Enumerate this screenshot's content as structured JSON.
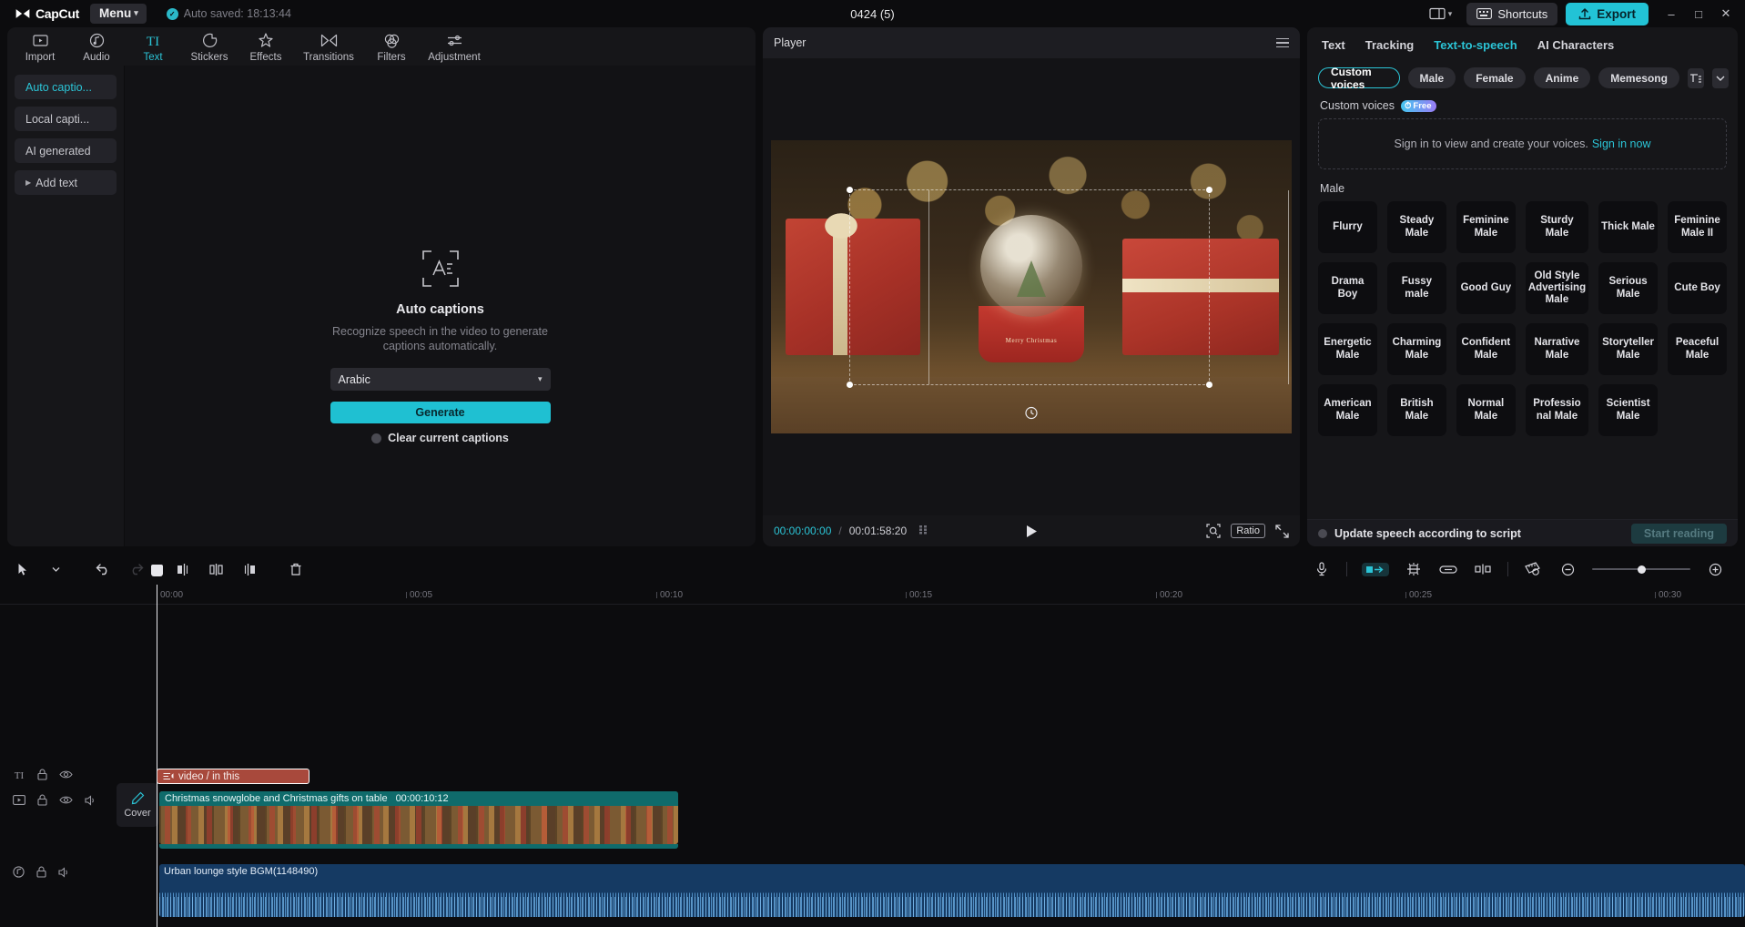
{
  "titlebar": {
    "brand": "CapCut",
    "menu_label": "Menu",
    "autosave_text": "Auto saved: 18:13:44",
    "project_title": "0424 (5)",
    "shortcuts_label": "Shortcuts",
    "export_label": "Export",
    "minimize": "–",
    "maximize": "□",
    "close": "✕"
  },
  "nav_tabs": [
    {
      "label": "Import",
      "icon": "import-icon",
      "active": false
    },
    {
      "label": "Audio",
      "icon": "audio-icon",
      "active": false
    },
    {
      "label": "Text",
      "icon": "text-icon",
      "active": true
    },
    {
      "label": "Stickers",
      "icon": "stickers-icon",
      "active": false
    },
    {
      "label": "Effects",
      "icon": "effects-icon",
      "active": false
    },
    {
      "label": "Transitions",
      "icon": "transitions-icon",
      "active": false
    },
    {
      "label": "Filters",
      "icon": "filters-icon",
      "active": false
    },
    {
      "label": "Adjustment",
      "icon": "adjustment-icon",
      "active": false
    }
  ],
  "subnav": [
    {
      "label": "Auto captio...",
      "active": true
    },
    {
      "label": "Local capti...",
      "active": false
    },
    {
      "label": "AI generated",
      "active": false
    },
    {
      "label": "Add text",
      "active": false,
      "expandable": true
    }
  ],
  "auto_captions": {
    "title": "Auto captions",
    "description": "Recognize speech in the video to generate captions automatically.",
    "language_value": "Arabic",
    "generate_label": "Generate",
    "clear_label": "Clear current captions",
    "clear_checked": false
  },
  "player": {
    "header_title": "Player",
    "current_time": "00:00:00:00",
    "separator": "/",
    "total_time": "00:01:58:20",
    "ratio_label": "Ratio",
    "play_icon": "play-icon",
    "zoom_icon": "magnifier-icon",
    "fullscreen_icon": "fullscreen-icon",
    "menu_icon": "hamburger-icon"
  },
  "right_panel": {
    "tabs": [
      {
        "label": "Text",
        "active": false
      },
      {
        "label": "Tracking",
        "active": false
      },
      {
        "label": "Text-to-speech",
        "active": true
      },
      {
        "label": "AI Characters",
        "active": false
      }
    ],
    "filter_chips": [
      {
        "label": "Custom voices",
        "active": true
      },
      {
        "label": "Male",
        "active": false
      },
      {
        "label": "Female",
        "active": false
      },
      {
        "label": "Anime",
        "active": false
      },
      {
        "label": "Memesong",
        "active": false
      }
    ],
    "filter_icon": "filter-sort-icon",
    "dropdown_icon": "chevron-down-icon",
    "custom_voices_label": "Custom voices",
    "free_badge": "Free",
    "signin_text": "Sign in to view and create your voices.",
    "signin_link": "Sign in now",
    "male_section_label": "Male",
    "voices": [
      "Flurry",
      "Steady Male",
      "Feminine Male",
      "Sturdy Male",
      "Thick Male",
      "Feminine Male II",
      "Drama Boy",
      "Fussy male",
      "Good Guy",
      "Old Style Advertising Male",
      "Serious Male",
      "Cute Boy",
      "Energetic Male",
      "Charming Male",
      "Confident Male",
      "Narrative Male",
      "Storyteller Male",
      "Peaceful Male",
      "American Male",
      "British Male",
      "Normal Male",
      "Professio nal Male",
      "Scientist Male"
    ],
    "update_speech_label": "Update speech according to script",
    "update_speech_checked": false,
    "start_reading_label": "Start reading"
  },
  "timeline": {
    "toolbar_icons": [
      "cursor-select-icon",
      "chevron-down-icon",
      "undo-icon",
      "redo-icon",
      "split-left-icon",
      "split-icon",
      "split-right-icon",
      "delete-icon"
    ],
    "right_icons": [
      "microphone-icon",
      "auto-fill-icon",
      "mix-icon",
      "link-icon",
      "cut-gap-icon",
      "ruler-icon",
      "zoom-out-icon",
      "zoom-in-icon"
    ],
    "ruler_ticks": [
      "00:00",
      "00:05",
      "00:10",
      "00:15",
      "00:20",
      "00:25",
      "00:30"
    ],
    "cover_label": "Cover",
    "clips": {
      "text_clip": {
        "label": "video / in this",
        "icon": "caption-icon"
      },
      "video_clip": {
        "label": "Christmas snowglobe and Christmas gifts on table",
        "duration": "00:00:10:12"
      },
      "audio_clip": {
        "label": "Urban lounge style BGM(1148490)"
      }
    },
    "track_controls": [
      {
        "icons": [
          "text-track-icon",
          "lock-icon",
          "eye-icon"
        ]
      },
      {
        "icons": [
          "video-track-icon",
          "lock-icon",
          "eye-icon",
          "volume-icon"
        ]
      },
      {
        "icons": [
          "audio-track-icon",
          "lock-icon",
          "volume-icon"
        ]
      }
    ]
  },
  "colors": {
    "accent": "#2bc4d6",
    "export": "#22c3d6",
    "text_clip": "#a8493c",
    "video_clip": "#0f6b6b",
    "audio_clip": "#153a63"
  }
}
